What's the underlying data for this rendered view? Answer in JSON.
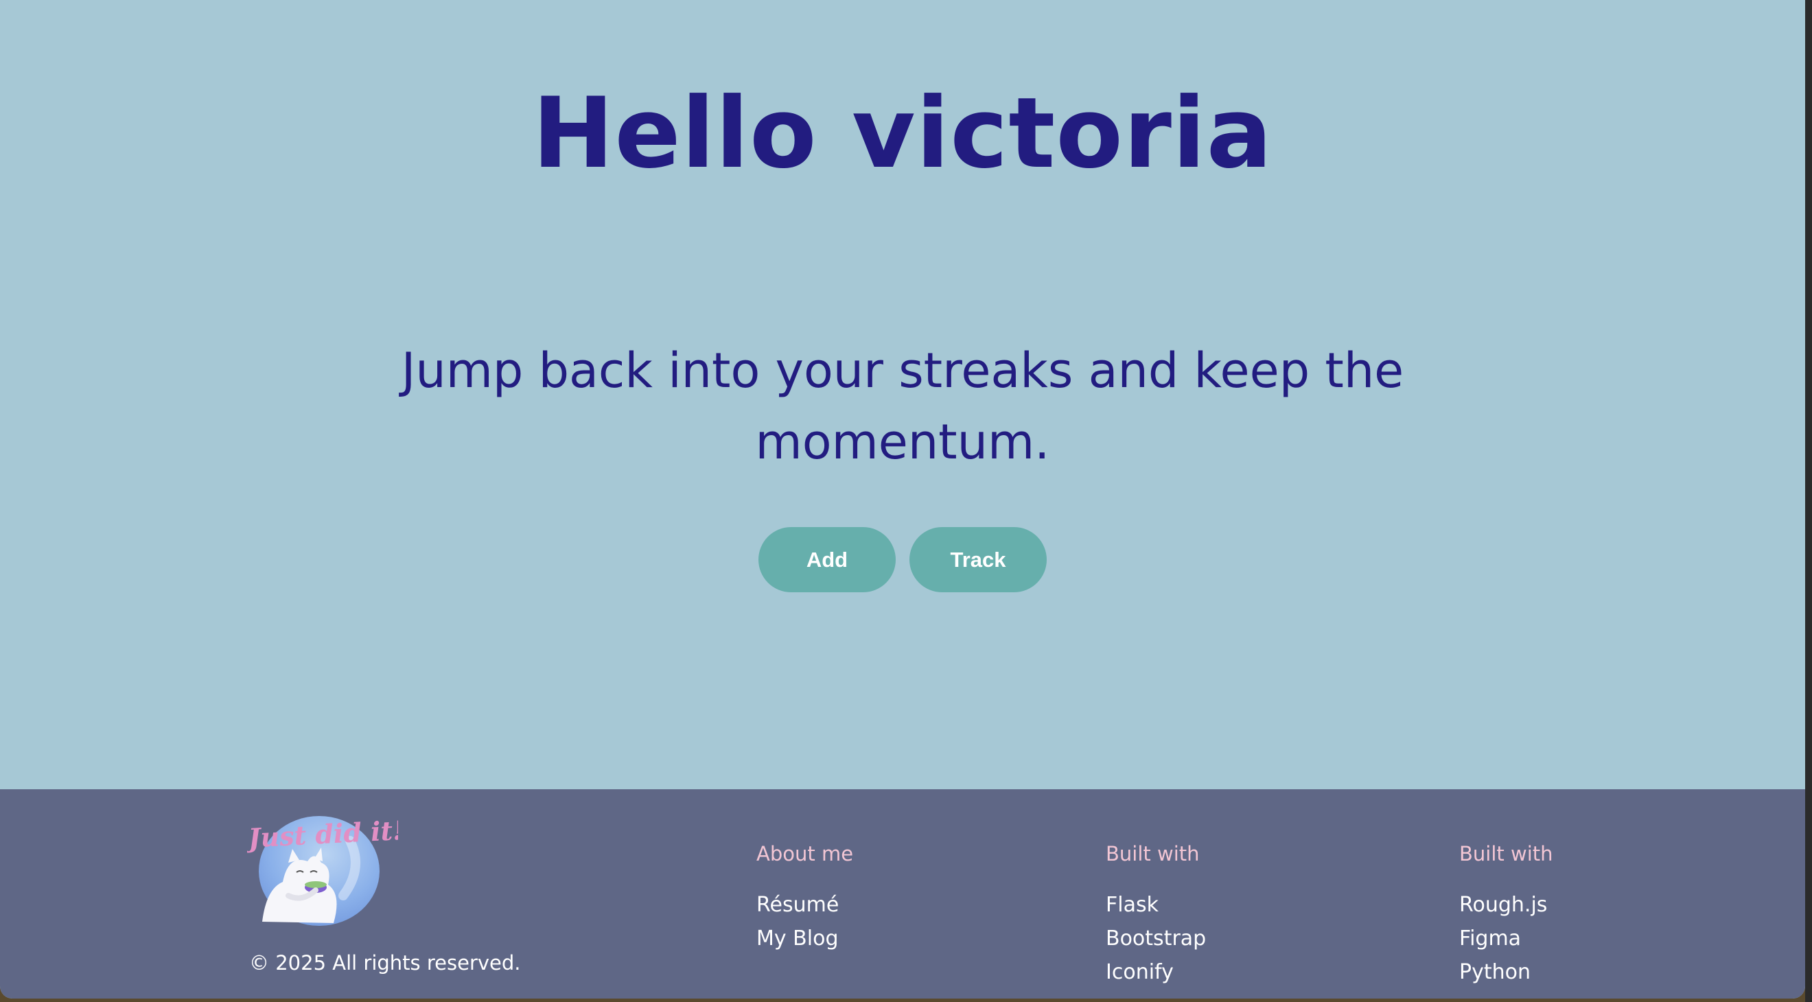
{
  "hero": {
    "title": "Hello victoria",
    "subtitle": "Jump back into your streaks and keep the momentum."
  },
  "actions": {
    "add_label": "Add",
    "track_label": "Track"
  },
  "footer": {
    "logo_text": "Just did it!",
    "copyright": "© 2025 All rights reserved.",
    "columns": [
      {
        "heading": "About me",
        "links": [
          "Résumé",
          "My Blog"
        ]
      },
      {
        "heading": "Built with",
        "links": [
          "Flask",
          "Bootstrap",
          "Iconify"
        ]
      },
      {
        "heading": "Built with",
        "links": [
          "Rough.js",
          "Figma",
          "Python"
        ]
      }
    ]
  },
  "colors": {
    "page_background": "#a6c8d5",
    "heading": "#221c80",
    "button": "#66afac",
    "footer_background": "#5f6786",
    "footer_heading": "#f2c6d4",
    "logo_text": "#e28fc4"
  }
}
